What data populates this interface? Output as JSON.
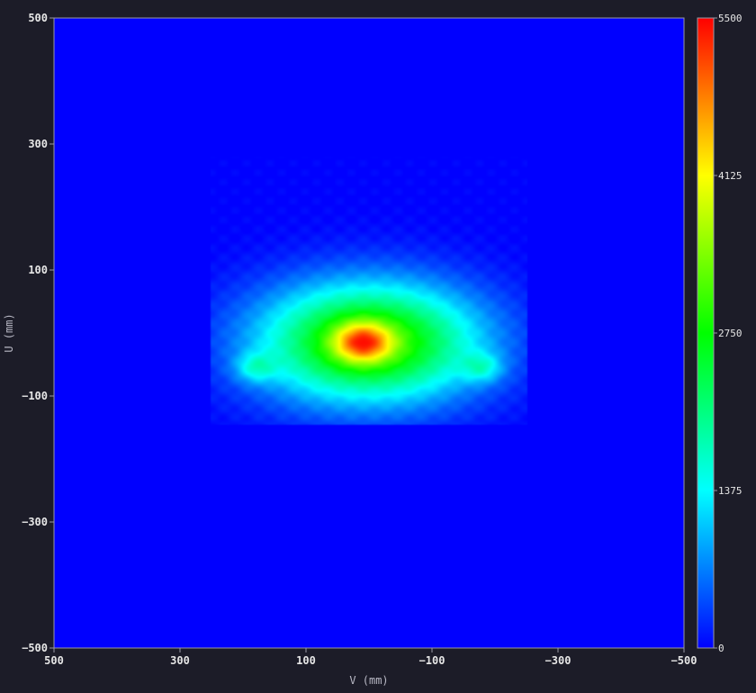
{
  "chart_data": {
    "type": "heatmap",
    "title": "",
    "xlabel": "V (mm)",
    "ylabel": "U (mm)",
    "xlim": [
      500,
      -500
    ],
    "ylim": [
      -500,
      500
    ],
    "x_ticks": [
      500,
      300,
      100,
      -100,
      -300,
      -500
    ],
    "y_ticks": [
      500,
      300,
      100,
      -100,
      -300,
      -500
    ],
    "colorbar": {
      "range": [
        0,
        5500
      ],
      "ticks": [
        0,
        1375,
        2750,
        4125,
        5500
      ],
      "colormap": "jet",
      "colors": [
        "#0000ff",
        "#00ffff",
        "#00ff00",
        "#ffff00",
        "#ff0000"
      ]
    },
    "grid": false,
    "background_color": "#0000ff",
    "data_region": {
      "v": [
        250,
        -250
      ],
      "u": [
        -145,
        280
      ]
    },
    "blobs": [
      {
        "v": 0,
        "u": -15,
        "sigma_v": 120,
        "sigma_u": 65,
        "peak": 3300
      },
      {
        "v": 10,
        "u": -15,
        "sigma_v": 32,
        "sigma_u": 22,
        "peak": 2200
      },
      {
        "v": 180,
        "u": -55,
        "sigma_v": 22,
        "sigma_u": 16,
        "peak": 900
      },
      {
        "v": -180,
        "u": -55,
        "sigma_v": 22,
        "sigma_u": 16,
        "peak": 900
      }
    ]
  }
}
